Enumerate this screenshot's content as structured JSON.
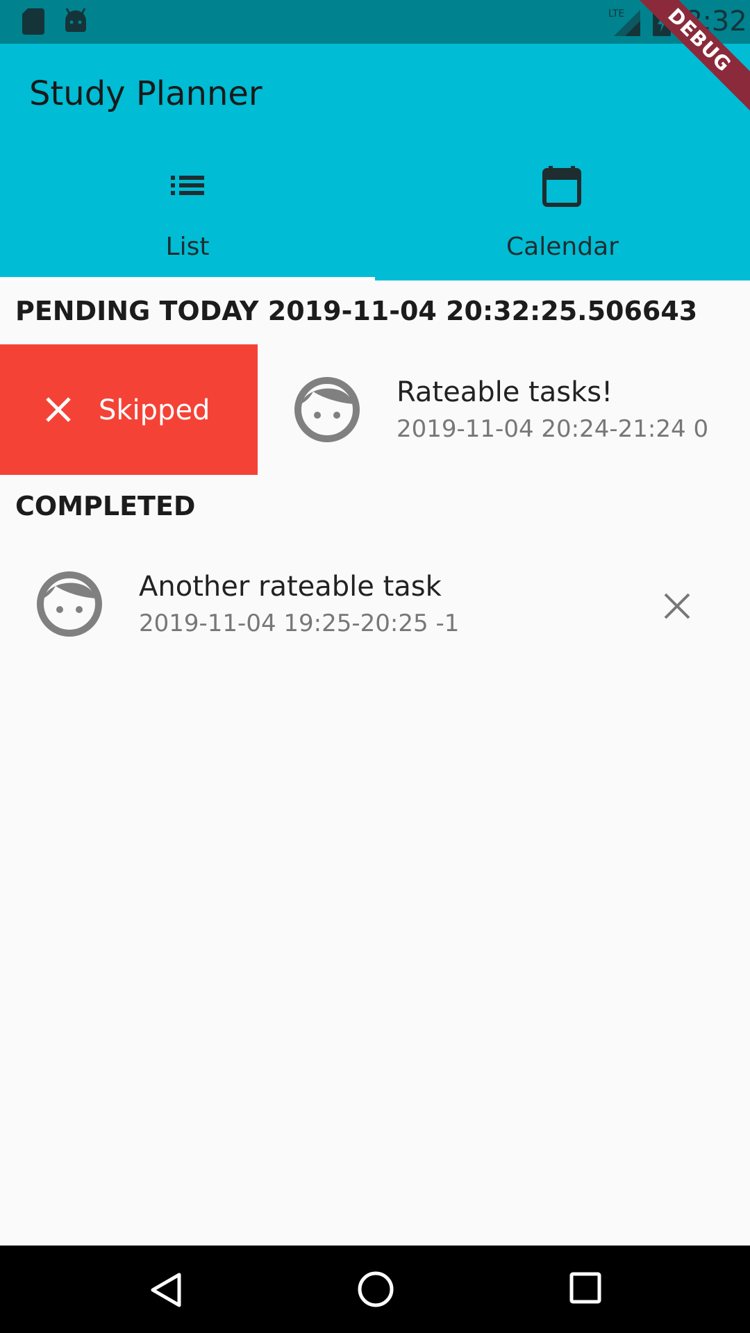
{
  "status_bar": {
    "time": "8:32",
    "icons": [
      "sd-card-icon",
      "android-icon",
      "lte-signal-icon",
      "battery-charging-icon"
    ]
  },
  "debug_banner": "DEBUG",
  "app": {
    "title": "Study Planner",
    "accent_color": "#00bcd4"
  },
  "tabs": [
    {
      "label": "List",
      "icon": "list-icon",
      "selected": true
    },
    {
      "label": "Calendar",
      "icon": "calendar-icon",
      "selected": false
    }
  ],
  "pending": {
    "header": "PENDING TODAY 2019-11-04 20:32:25.506643",
    "swipe_action": {
      "label": "Skipped",
      "icon": "close-icon",
      "color": "#f44336"
    },
    "items": [
      {
        "title": "Rateable tasks!",
        "subtitle": "2019-11-04 20:24-21:24 0",
        "icon": "face-icon"
      }
    ]
  },
  "completed": {
    "header": "COMPLETED",
    "items": [
      {
        "title": "Another rateable task",
        "subtitle": "2019-11-04 19:25-20:25 -1",
        "icon": "face-icon",
        "action_icon": "close-icon"
      }
    ]
  },
  "nav_bar": {
    "icons": [
      "back-icon",
      "home-icon",
      "recent-apps-icon"
    ]
  }
}
